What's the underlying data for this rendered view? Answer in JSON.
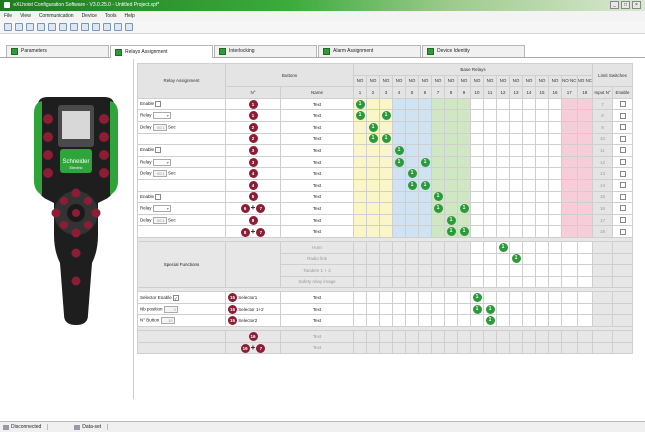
{
  "window": {
    "title": "eXLhoist Configuration Software - V3.0.25.0 - Untitled Project.xpf*"
  },
  "menu": [
    "File",
    "View",
    "Communication",
    "Device",
    "Tools",
    "Help"
  ],
  "tabs": [
    {
      "label": "Parameters"
    },
    {
      "label": "Relays Assignment"
    },
    {
      "label": "Interlocking"
    },
    {
      "label": "Alarm Assignment"
    },
    {
      "label": "Device Identity"
    }
  ],
  "device": {
    "brand": "Schneider",
    "sub": "Electric"
  },
  "grid": {
    "relay_assignment_label": "Relay Assignment",
    "buttons_label": "Buttons",
    "base_relays_label": "Base Relays",
    "limit_switches_label": "Limit Switches",
    "aocf": "A.O.C.F",
    "n_label": "N°",
    "name_label": "Name",
    "input_n": "Input N°",
    "enable_label": "Enable",
    "relay_types": [
      "NO",
      "NO",
      "NO",
      "NO",
      "NO",
      "NO",
      "NO",
      "NO",
      "NO",
      "NO",
      "NO",
      "NO",
      "NO",
      "NO",
      "NO",
      "NO",
      "NO NC",
      "NO NC"
    ],
    "relay_numbers": [
      "1",
      "2",
      "3",
      "4",
      "5",
      "6",
      "7",
      "8",
      "9",
      "10",
      "11",
      "12",
      "13",
      "14",
      "15",
      "16",
      "17",
      "18"
    ],
    "cfg_labels": {
      "enable": "Enable",
      "relay": "Relay",
      "delay": "Delay",
      "delay_val": "00.1",
      "sec": "Sec"
    },
    "rows": [
      {
        "btn": [
          "1"
        ],
        "name": "Text",
        "input": "7",
        "greens": [
          [
            0,
            "1"
          ]
        ]
      },
      {
        "btn": [
          "1b"
        ],
        "name": "Text",
        "input": "8",
        "greens": [
          [
            0,
            "1"
          ],
          [
            2,
            "1"
          ]
        ]
      },
      {
        "btn": [
          "2"
        ],
        "name": "Text",
        "input": "9",
        "greens": [
          [
            1,
            "1"
          ]
        ]
      },
      {
        "btn": [
          "2b"
        ],
        "name": "Text",
        "input": "10",
        "greens": [
          [
            1,
            "1"
          ],
          [
            2,
            "1"
          ]
        ]
      },
      {
        "btn": [
          "3"
        ],
        "name": "Text",
        "input": "11",
        "greens": [
          [
            3,
            "1"
          ]
        ]
      },
      {
        "btn": [
          "3b"
        ],
        "name": "Text",
        "input": "12",
        "greens": [
          [
            3,
            "1"
          ],
          [
            5,
            "1"
          ]
        ]
      },
      {
        "btn": [
          "4"
        ],
        "name": "Text",
        "input": "13",
        "greens": [
          [
            4,
            "1"
          ]
        ]
      },
      {
        "btn": [
          "4b"
        ],
        "name": "Text",
        "input": "14",
        "greens": [
          [
            4,
            "1"
          ],
          [
            5,
            "1"
          ]
        ]
      },
      {
        "btn": [
          "5"
        ],
        "name": "Text",
        "input": "15",
        "greens": [
          [
            6,
            "1"
          ]
        ]
      },
      {
        "btn": [
          "6",
          "7"
        ],
        "name": "Text",
        "input": "16",
        "greens": [
          [
            6,
            "1"
          ],
          [
            8,
            "1"
          ]
        ]
      },
      {
        "btn": [
          "8"
        ],
        "name": "Text",
        "input": "17",
        "greens": [
          [
            7,
            "1"
          ]
        ]
      },
      {
        "btn": [
          "8",
          "7"
        ],
        "name": "Text",
        "input": "18",
        "greens": [
          [
            7,
            "1"
          ],
          [
            8,
            "1"
          ]
        ]
      }
    ],
    "special_label": "Special Functions",
    "special_rows": [
      {
        "name": "Horn",
        "greens": [
          [
            11,
            "1"
          ]
        ]
      },
      {
        "name": "Radio link",
        "greens": [
          [
            12,
            "1"
          ]
        ]
      },
      {
        "name": "Tandem 1 + 2",
        "greens": []
      },
      {
        "name": "Safety relay image",
        "greens": []
      }
    ],
    "selector_cfg": {
      "enable": "Selector Enable",
      "nb_position": "Nb position",
      "nb_value": "3",
      "n_button": "N° Button",
      "n_value": "15"
    },
    "selector_rows": [
      {
        "btn": "15",
        "sel": "Selector1",
        "name": "Text",
        "greens": [
          [
            9,
            "1"
          ]
        ]
      },
      {
        "btn": "15",
        "sel": "Selector 1+2",
        "name": "Text",
        "greens": [
          [
            9,
            "1"
          ],
          [
            10,
            "1"
          ]
        ]
      },
      {
        "btn": "15",
        "sel": "Selector2",
        "name": "Text",
        "greens": [
          [
            10,
            "1"
          ]
        ]
      }
    ],
    "extra_rows": [
      {
        "btn": [
          "16"
        ],
        "name": "Text"
      },
      {
        "btn": [
          "16",
          "7"
        ],
        "name": "Text"
      }
    ]
  },
  "status": {
    "connection": "Disconnected",
    "dataset": "Data-set"
  },
  "colors": {
    "green": "#2a9a3a",
    "burgundy": "#8c1d35"
  }
}
